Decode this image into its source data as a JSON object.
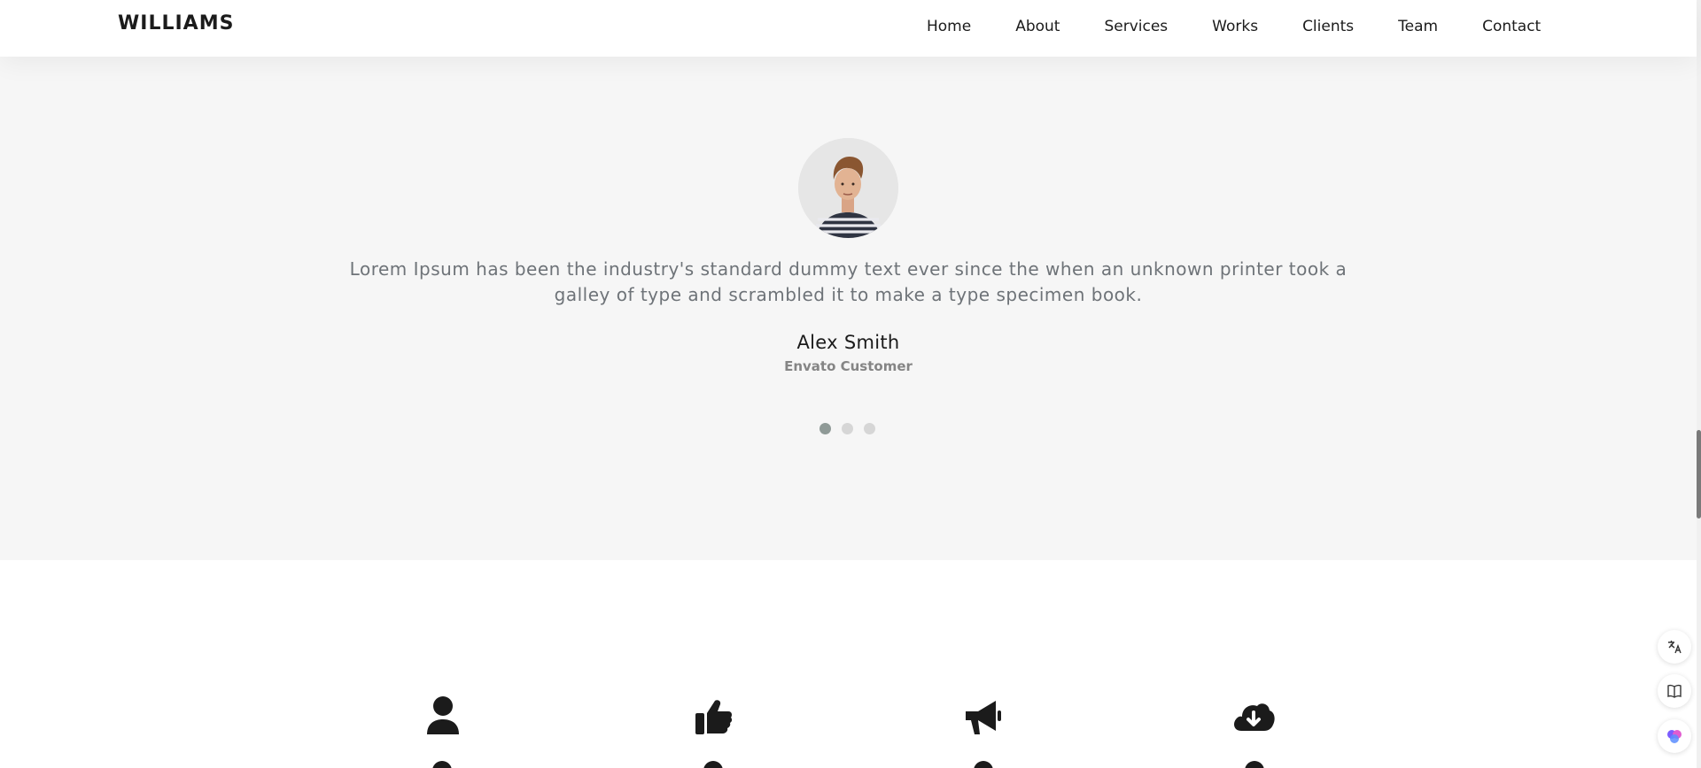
{
  "header": {
    "logo": "WILLIAMS",
    "nav": [
      "Home",
      "About",
      "Services",
      "Works",
      "Clients",
      "Team",
      "Contact"
    ]
  },
  "testimonial": {
    "quote": "Lorem Ipsum has been the industry's standard dummy text ever since the when an unknown printer took a galley of type and scrambled it to make a type specimen book.",
    "name": "Alex Smith",
    "role": "Envato Customer",
    "slide_count": 3,
    "active_slide": 1
  },
  "features": {
    "icons": [
      "user-icon",
      "thumbs-up-icon",
      "megaphone-icon",
      "cloud-download-icon"
    ]
  },
  "floating_tools": [
    "translate-icon",
    "book-icon",
    "ai-brain-icon"
  ],
  "colors": {
    "text_dark": "#1b1b1b",
    "quote_gray": "#6e7378",
    "section_bg": "#f6f6f6",
    "dot_active": "#8f9a97",
    "dot_inactive": "#d6d6d6"
  }
}
